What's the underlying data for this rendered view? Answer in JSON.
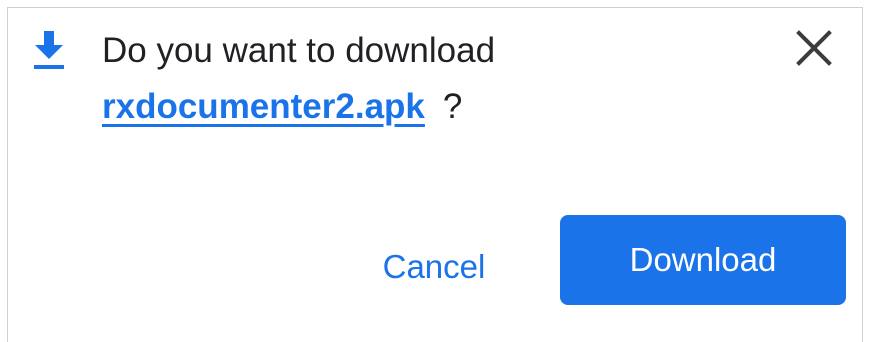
{
  "dialog": {
    "icon": "download-icon",
    "message_prefix": "Do you want to download",
    "file_name": "rxdocumenter2.apk",
    "question_mark": "?",
    "close_icon": "close-icon",
    "cancel_label": "Cancel",
    "download_label": "Download"
  },
  "colors": {
    "accent": "#1a73e8",
    "text": "#202124",
    "background": "#ffffff"
  }
}
